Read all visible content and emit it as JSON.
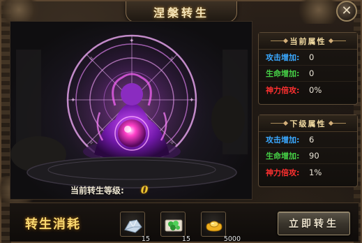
{
  "window": {
    "title": "涅槃转生"
  },
  "scene": {
    "level_label": "当前转生等级:",
    "level_value": "0"
  },
  "current_attributes": {
    "header": "当前属性",
    "rows": [
      {
        "label": "攻击增加:",
        "value": "0",
        "color": "#3aa8ff"
      },
      {
        "label": "生命增加:",
        "value": "0",
        "color": "#46d046"
      },
      {
        "label": "神力倍攻:",
        "value": "0%",
        "color": "#ff3030"
      }
    ]
  },
  "next_attributes": {
    "header": "下级属性",
    "rows": [
      {
        "label": "攻击增加:",
        "value": "6",
        "color": "#3aa8ff"
      },
      {
        "label": "生命增加:",
        "value": "90",
        "color": "#46d046"
      },
      {
        "label": "神力倍攻:",
        "value": "1%",
        "color": "#ff3030"
      }
    ]
  },
  "cost": {
    "title": "转生消耗",
    "items": [
      {
        "icon": "crystal-powder-icon",
        "count": "15"
      },
      {
        "icon": "green-jade-icon",
        "count": "15"
      },
      {
        "icon": "gold-ingot-icon",
        "count": "5000"
      }
    ],
    "button_label": "立即转生"
  },
  "colors": {
    "title_gold": "#f4e4b8",
    "accent_gold": "#f8d870",
    "magic_purple": "#c43cff",
    "frame_brown": "#5b4630"
  }
}
